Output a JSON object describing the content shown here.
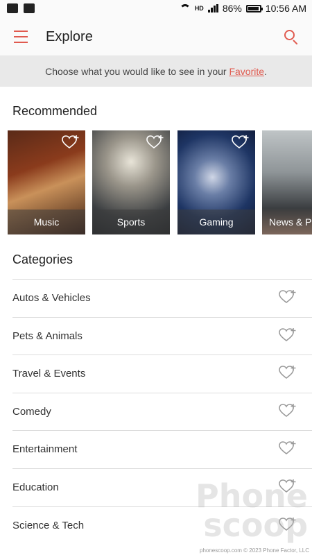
{
  "status_bar": {
    "left_icons": [
      "gmail-icon",
      "image-icon"
    ],
    "network_label": "HD",
    "battery": "86%",
    "battery_level": 0.86,
    "time": "10:56 AM"
  },
  "app_bar": {
    "title": "Explore",
    "accent_color": "#e05a4f"
  },
  "banner": {
    "text_prefix": "Choose what you would like to see in your ",
    "link_text": "Favorite",
    "text_suffix": "."
  },
  "recommended": {
    "heading": "Recommended",
    "cards": [
      {
        "label": "Music"
      },
      {
        "label": "Sports"
      },
      {
        "label": "Gaming"
      },
      {
        "label": "News & Po"
      }
    ]
  },
  "categories": {
    "heading": "Categories",
    "items": [
      {
        "label": "Autos & Vehicles"
      },
      {
        "label": "Pets & Animals"
      },
      {
        "label": "Travel & Events"
      },
      {
        "label": "Comedy"
      },
      {
        "label": "Entertainment"
      },
      {
        "label": "Education"
      },
      {
        "label": "Science & Tech"
      }
    ]
  },
  "watermark": {
    "line1": "Phone",
    "line2": "scoop",
    "credit": "phonescoop.com  © 2023 Phone Factor, LLC"
  }
}
